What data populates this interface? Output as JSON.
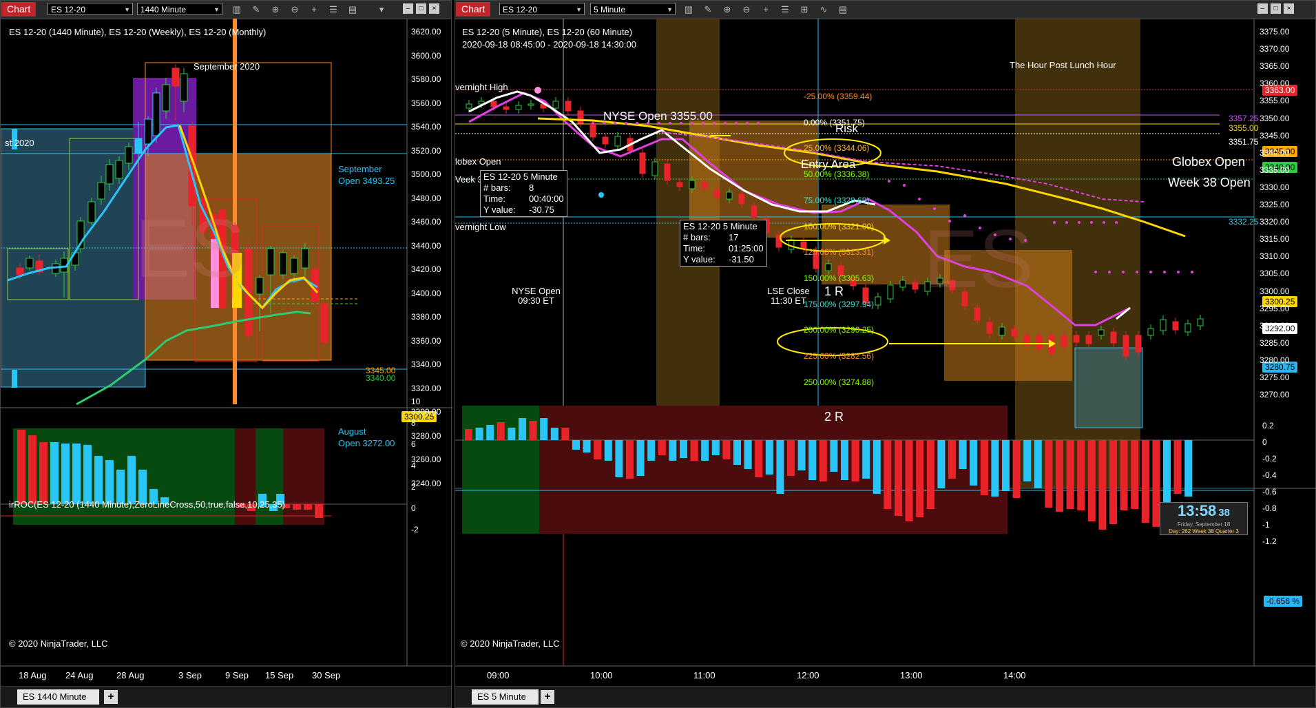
{
  "left": {
    "chart_button": "Chart",
    "instrument": "ES 12-20",
    "interval": "1440 Minute",
    "title": "ES 12-20 (1440 Minute), ES 12-20 (Weekly), ES 12-20 (Monthly)",
    "labels": {
      "month": "September 2020",
      "august_frag": "st 2020",
      "sept_open": "September",
      "sept_open_val": "Open 3493.25",
      "aug_open": "August",
      "aug_open_val": "Open 3272.00",
      "p3345": "3345.00",
      "p3340": "3340.00",
      "watermark": "ES"
    },
    "price_tag": "3300.25",
    "y_axis": [
      "3620.00",
      "3600.00",
      "3580.00",
      "3560.00",
      "3540.00",
      "3520.00",
      "3500.00",
      "3480.00",
      "3460.00",
      "3440.00",
      "3420.00",
      "3400.00",
      "3380.00",
      "3360.00",
      "3340.00",
      "3320.00",
      "3300.00",
      "3280.00",
      "3260.00",
      "3240.00"
    ],
    "indicator_title": "irROC(ES 12-20 (1440 Minute),ZeroLineCross,50,true,false,10,25,35)",
    "ind_axis": [
      "10",
      "8",
      "6",
      "4",
      "2",
      "0",
      "-2"
    ],
    "copyright": "© 2020 NinjaTrader, LLC",
    "x_axis": [
      "18 Aug",
      "24 Aug",
      "28 Aug",
      "3 Sep",
      "9 Sep",
      "15 Sep",
      "30 Sep"
    ],
    "tab_label": "ES  1440 Minute",
    "tab_add": "+"
  },
  "right": {
    "chart_button": "Chart",
    "instrument": "ES 12-20",
    "interval": "5 Minute",
    "title": "ES 12-20 (5 Minute), ES 12-20 (60 Minute)",
    "range": "2020-09-18 08:45:00 - 2020-09-18 14:30:00",
    "labels": {
      "overnight_high": "vernight High",
      "nyse_open_price": "NYSE Open 3355.00",
      "risk": "Risk",
      "globex_open_frag": "lobex Open",
      "week_frag": "Veek 3",
      "entry_area": "Entry Area",
      "overnight_low": "vernight Low",
      "nyse_open": "NYSE Open",
      "nyse_time": "09:30 ET",
      "lse_close": "LSE Close",
      "lse_time": "11:30 ET",
      "one_r": "1 R",
      "two_r": "2 R",
      "hour_post_lunch": "The Hour Post Lunch Hour",
      "globex_open": "Globex Open",
      "week38_open": "Week 38 Open",
      "v3357": "3357.25",
      "v3355": "3355.00",
      "v3351": "3351.75",
      "v3332": "3332.25",
      "watermark": "ES"
    },
    "fib_levels": [
      "-25.00% (3359.44)",
      "0.00% (3351.75)",
      "25.00% (3344.06)",
      "50.00% (3336.38)",
      "75.00% (3328.69)",
      "100.00% (3321.00)",
      "125.00% (3313.31)",
      "150.00% (3305.63)",
      "175.00% (3297.94)",
      "200.00% (3290.25)",
      "225.00% (3282.56)",
      "250.00% (3274.88)"
    ],
    "fib_colors": [
      "#ff8c2a",
      "#ffffff",
      "#ffb347",
      "#7fff00",
      "#40e0d0",
      "#ffd700",
      "#ff8c2a",
      "#7fff00",
      "#40e0d0",
      "#7fff00",
      "#ff8c2a",
      "#7fff00"
    ],
    "infobox1": {
      "title": "ES 12-20 5 Minute",
      "rows": [
        [
          "# bars:",
          "8"
        ],
        [
          "Time:",
          "00:40:00"
        ],
        [
          "Y value:",
          "-30.75"
        ]
      ]
    },
    "infobox2": {
      "title": "ES 12-20 5 Minute",
      "rows": [
        [
          "# bars:",
          "17"
        ],
        [
          "Time:",
          "01:25:00"
        ],
        [
          "Y value:",
          "-31.50"
        ]
      ]
    },
    "price_tags": [
      {
        "text": "3363.00",
        "bg": "#e8232a",
        "fg": "#fff"
      },
      {
        "text": "3345.00",
        "bg": "#ffa500",
        "fg": "#000"
      },
      {
        "text": "3340.00",
        "bg": "#2ecc40",
        "fg": "#000"
      },
      {
        "text": "3300.25",
        "bg": "#ffd700",
        "fg": "#000"
      },
      {
        "text": "3292.00",
        "bg": "#ffffff",
        "fg": "#000"
      },
      {
        "text": "3280.75",
        "bg": "#29b6f6",
        "fg": "#000"
      }
    ],
    "y_axis": [
      "3375.00",
      "3370.00",
      "3365.00",
      "3360.00",
      "3355.00",
      "3350.00",
      "3345.00",
      "3340.00",
      "3335.00",
      "3330.00",
      "3325.00",
      "3320.00",
      "3315.00",
      "3310.00",
      "3305.00",
      "3300.00",
      "3295.00",
      "3290.00",
      "3285.00",
      "3280.00",
      "3275.00",
      "3270.00"
    ],
    "ind_axis": [
      "0.2",
      "0",
      "-0.2",
      "-0.4",
      "-0.6",
      "-0.8",
      "-1",
      "-1.2"
    ],
    "ind_tag": "-0.656 %",
    "clock": {
      "time": "13:58",
      "sec": "38",
      "line1": "Friday, September 18",
      "line2": "Day: 262  Week 38  Quarter 3"
    },
    "copyright": "© 2020 NinjaTrader, LLC",
    "x_axis": [
      "09:00",
      "10:00",
      "11:00",
      "12:00",
      "13:00",
      "14:00"
    ],
    "tab_label": "ES  5 Minute",
    "tab_add": "+"
  },
  "icons": [
    "bar-chart-icon",
    "pencil-icon",
    "zoom-in-icon",
    "zoom-out-icon",
    "crosshair-icon",
    "properties-icon",
    "strategy-icon",
    "chevron-down-icon",
    "minimize-icon",
    "maximize-icon",
    "close-icon"
  ]
}
